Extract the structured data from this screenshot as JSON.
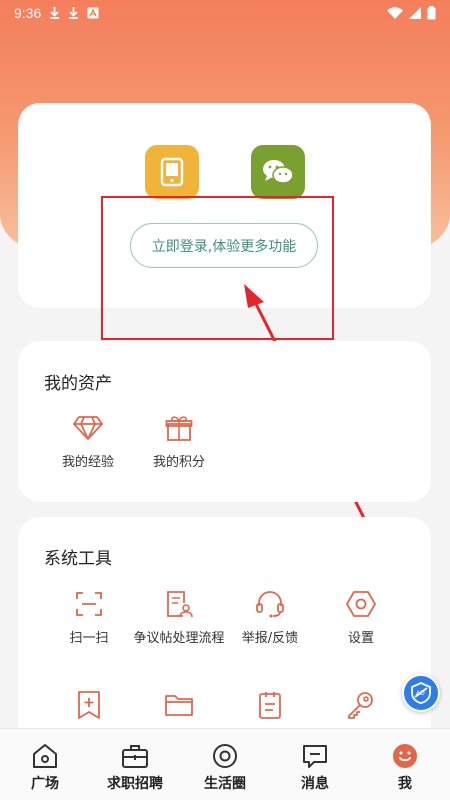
{
  "status_bar": {
    "time": "9:36"
  },
  "login": {
    "button_label": "立即登录,体验更多功能",
    "phone_icon": "phone-icon",
    "wechat_icon": "wechat-icon"
  },
  "assets": {
    "title": "我的资产",
    "items": [
      {
        "label": "我的经验",
        "icon": "diamond-icon"
      },
      {
        "label": "我的积分",
        "icon": "gift-icon"
      }
    ]
  },
  "tools": {
    "title": "系统工具",
    "items": [
      {
        "label": "扫一扫",
        "icon": "scan-icon"
      },
      {
        "label": "争议帖处理流程",
        "icon": "document-user-icon"
      },
      {
        "label": "举报/反馈",
        "icon": "headset-icon"
      },
      {
        "label": "设置",
        "icon": "hexagon-settings-icon"
      },
      {
        "label": "",
        "icon": "bookmark-add-icon"
      },
      {
        "label": "",
        "icon": "folder-icon"
      },
      {
        "label": "",
        "icon": "clipboard-icon"
      },
      {
        "label": "",
        "icon": "key-icon"
      }
    ]
  },
  "nav": {
    "items": [
      {
        "label": "广场",
        "icon": "home-icon"
      },
      {
        "label": "求职招聘",
        "icon": "briefcase-icon"
      },
      {
        "label": "生活圈",
        "icon": "circle-icon"
      },
      {
        "label": "消息",
        "icon": "message-icon"
      },
      {
        "label": "我",
        "icon": "profile-icon"
      }
    ]
  },
  "colors": {
    "accent": "#e0684a",
    "hero_top": "#f47e5c",
    "login_text": "#3d8f7e",
    "highlight": "#e6252a"
  }
}
